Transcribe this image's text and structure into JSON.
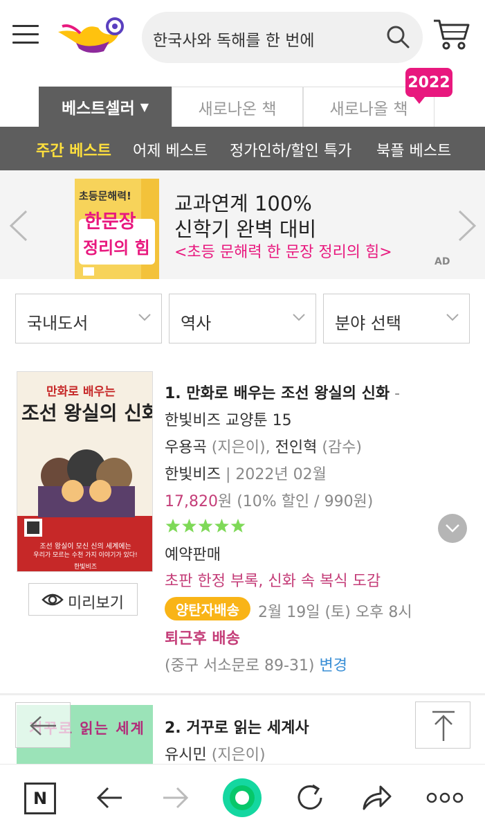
{
  "search": {
    "text": "한국사와 독해를 한 번에"
  },
  "tabs": {
    "bestseller": "베스트셀러",
    "new_books": "새로나온 책",
    "coming_books": "새로나올 책",
    "badge": "2022"
  },
  "subnav": [
    "주간 베스트",
    "어제 베스트",
    "정가인하/할인 특가",
    "북플 베스트"
  ],
  "banner": {
    "cover_lines": [
      "초등문해력!",
      "한문장",
      "정리의 힘"
    ],
    "line1": "교과연계 100%",
    "line2": "신학기 완벽 대비",
    "line3": "<초등 문해력 한 문장 정리의 힘>",
    "ad": "AD"
  },
  "filters": [
    "국내도서",
    "역사",
    "분야 선택"
  ],
  "product1": {
    "cover": {
      "top": "만화로 배우는",
      "title": "조선 왕실의 신화",
      "bottom_line1": "조선 왕실이 모신 신의 세계에는",
      "bottom_line2": "우리가 모르는 수천 가지 이야기가 있다!",
      "publisher": "한빛비즈"
    },
    "preview_label": "미리보기",
    "rank_title": "1. 만화로 배우는 조선 왕실의 신화",
    "title_dash": " -",
    "series": "한빛비즈 교양툰 15",
    "author1": "우용곡",
    "author1_role": " (지은이), ",
    "author2": "전인혁",
    "author2_role": " (감수)",
    "publisher": "한빛비즈",
    "date": " | 2022년 02월",
    "price": "17,820",
    "price_suffix": "원 (10% 할인 / 990원)",
    "rating": 5,
    "status": "예약판매",
    "gift": "초판 한정 부록, 신화 속 복식 도감",
    "delivery_badge": "양탄자배송",
    "delivery_time": "2월 19일 (토) 오후 8시",
    "delivery_note": "퇴근후 배송",
    "address": "(중구 서소문로 89-31) ",
    "change": "변경"
  },
  "product2": {
    "cover_title": "거꾸로 읽는 세계",
    "rank_title": "2. 거꾸로 읽는 세계사",
    "author": "유시민",
    "author_role": " (지은이)"
  },
  "toolbar": {
    "home_letter": "N"
  },
  "colors": {
    "accent_pink": "#e8187e",
    "price_pink": "#c43d78",
    "nav_gray": "#5e5e5e",
    "active_yellow": "#ffe03d",
    "badge_orange": "#f9b417",
    "link_blue": "#3a8fd6"
  }
}
